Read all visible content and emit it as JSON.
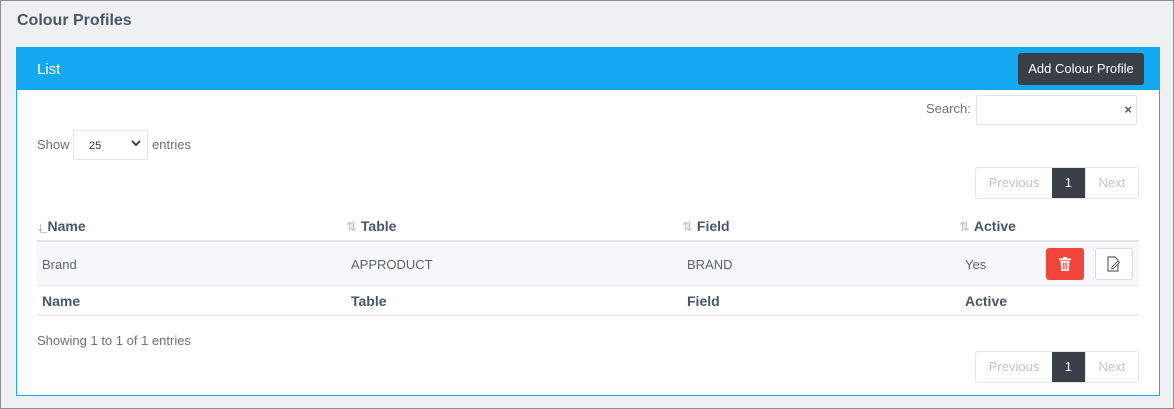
{
  "page": {
    "title": "Colour Profiles"
  },
  "panel": {
    "title": "List",
    "add_label": "Add Colour Profile"
  },
  "search": {
    "label": "Search:",
    "value": "",
    "clear_icon": "×"
  },
  "length": {
    "show_label": "Show",
    "value": "25",
    "entries_label": "entries"
  },
  "pager": {
    "previous": "Previous",
    "current": "1",
    "next": "Next"
  },
  "table": {
    "columns": [
      "Name",
      "Table",
      "Field",
      "Active"
    ],
    "rows": [
      {
        "name": "Brand",
        "table": "APPRODUCT",
        "field": "BRAND",
        "active": "Yes"
      }
    ],
    "footer": [
      "Name",
      "Table",
      "Field",
      "Active"
    ]
  },
  "info": "Showing 1 to 1 of 1 entries",
  "colors": {
    "accent": "#13a8ef",
    "dark": "#3a3f45",
    "danger": "#f0453a"
  },
  "icons": {
    "sort": "sort-icon",
    "delete": "trash-icon",
    "edit": "edit-icon"
  }
}
